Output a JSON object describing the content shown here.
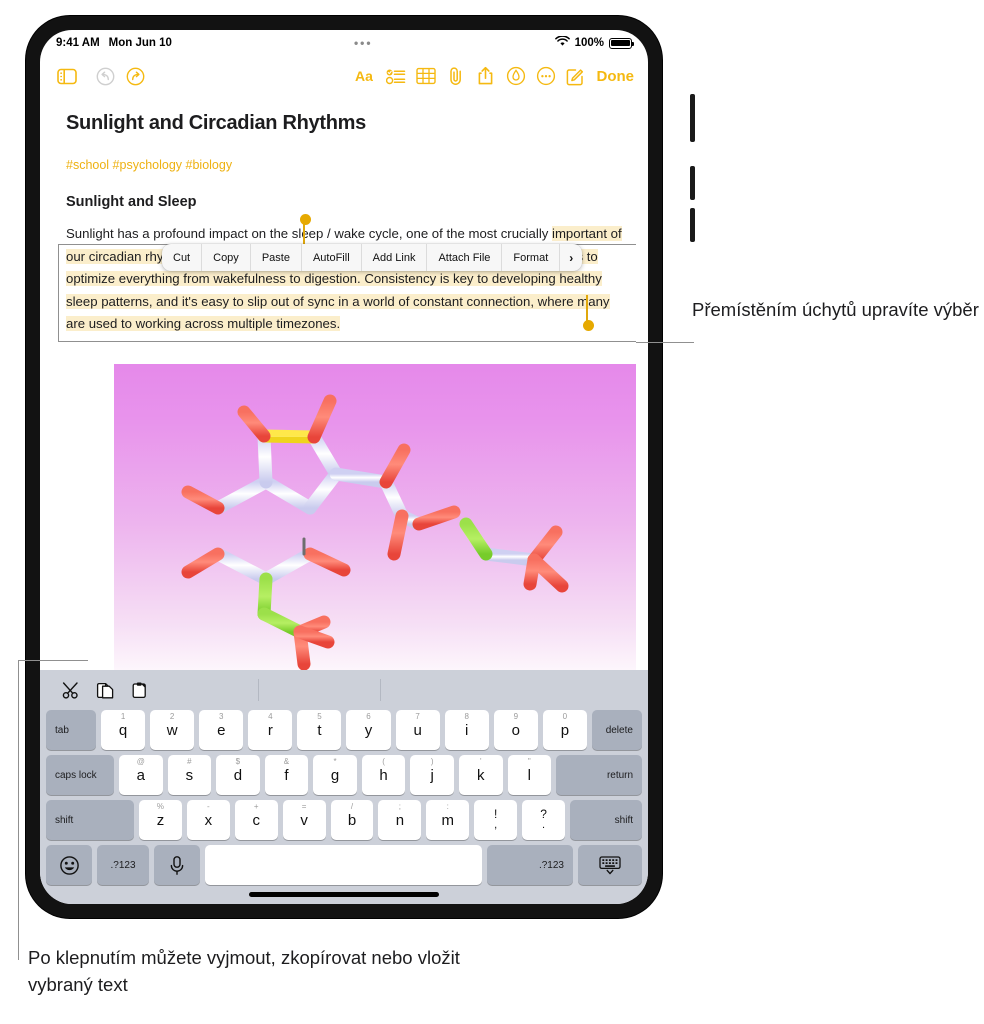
{
  "status_bar": {
    "time": "9:41 AM",
    "date": "Mon Jun 10",
    "battery_percent": "100%",
    "wifi_icon": "wifi-icon",
    "battery_icon": "battery-icon",
    "dots_icon": "dynamic-island-dots-icon"
  },
  "toolbar": {
    "sidebar_icon": "sidebar-toggle-icon",
    "undo_icon": "undo-icon",
    "redo_icon": "redo-icon",
    "format_icon": "format-aa-icon",
    "checklist_icon": "checklist-icon",
    "table_icon": "table-icon",
    "attach_icon": "paperclip-icon",
    "share_icon": "share-icon",
    "markup_icon": "markup-pen-icon",
    "more_icon": "more-ellipsis-icon",
    "compose_icon": "compose-icon",
    "done_label": "Done"
  },
  "note": {
    "title": "Sunlight and Circadian Rhythms",
    "tags": "#school #psychology #biology",
    "heading": "Sunlight and Sleep",
    "paragraph_lead": "Sunlight has a profound impact on the sleep / wake cycle, one of the most crucially",
    "paragraph_selected": "important of our circadian rhythms—a series of cyclical processes that help time our bodies' functions to optimize everything from wakefulness to digestion. Consistency is key to developing healthy sleep patterns, and it's easy to slip out of sync in a world of constant connection, where many are used to working across multiple timezones.",
    "selection_highlight_color": "#fbeecb",
    "handle_color": "#e6a900",
    "accent_color": "#f5b911",
    "image_alt": "molecule-illustration"
  },
  "edit_menu": {
    "items": [
      {
        "label": "Cut"
      },
      {
        "label": "Copy"
      },
      {
        "label": "Paste"
      },
      {
        "label": "AutoFill"
      },
      {
        "label": "Add Link"
      },
      {
        "label": "Attach File"
      },
      {
        "label": "Format"
      }
    ],
    "more_chevron": "›"
  },
  "keyboard": {
    "shortcut_bar": {
      "cut_icon": "scissors-icon",
      "copy_icon": "copy-icon",
      "paste_icon": "paste-icon"
    },
    "row1": {
      "tab": "tab",
      "keys": [
        {
          "hint": "1",
          "label": "q"
        },
        {
          "hint": "2",
          "label": "w"
        },
        {
          "hint": "3",
          "label": "e"
        },
        {
          "hint": "4",
          "label": "r"
        },
        {
          "hint": "5",
          "label": "t"
        },
        {
          "hint": "6",
          "label": "y"
        },
        {
          "hint": "7",
          "label": "u"
        },
        {
          "hint": "8",
          "label": "i"
        },
        {
          "hint": "9",
          "label": "o"
        },
        {
          "hint": "0",
          "label": "p"
        }
      ],
      "delete": "delete"
    },
    "row2": {
      "caps_lock": "caps lock",
      "keys": [
        {
          "hint": "@",
          "label": "a"
        },
        {
          "hint": "#",
          "label": "s"
        },
        {
          "hint": "$",
          "label": "d"
        },
        {
          "hint": "&",
          "label": "f"
        },
        {
          "hint": "*",
          "label": "g"
        },
        {
          "hint": "(",
          "label": "h"
        },
        {
          "hint": ")",
          "label": "j"
        },
        {
          "hint": "'",
          "label": "k"
        },
        {
          "hint": "\"",
          "label": "l"
        }
      ],
      "return": "return"
    },
    "row3": {
      "shift_left": "shift",
      "keys": [
        {
          "hint": "%",
          "label": "z"
        },
        {
          "hint": "-",
          "label": "x"
        },
        {
          "hint": "+",
          "label": "c"
        },
        {
          "hint": "=",
          "label": "v"
        },
        {
          "hint": "/",
          "label": "b"
        },
        {
          "hint": ";",
          "label": "n"
        },
        {
          "hint": ":",
          "label": "m"
        }
      ],
      "punct": [
        {
          "up": "!",
          "lo": ","
        },
        {
          "up": "?",
          "lo": "."
        }
      ],
      "shift_right": "shift"
    },
    "row4": {
      "emoji_icon": "emoji-icon",
      "numeric_left": ".?123",
      "mic_icon": "microphone-icon",
      "space": "",
      "numeric_right": ".?123",
      "dismiss_icon": "dismiss-keyboard-icon"
    }
  },
  "callouts": {
    "right": "Přemístěním úchytů upravíte výběr",
    "bottom": "Po klepnutím můžete vyjmout, zkopírovat nebo vložit vybraný text"
  }
}
